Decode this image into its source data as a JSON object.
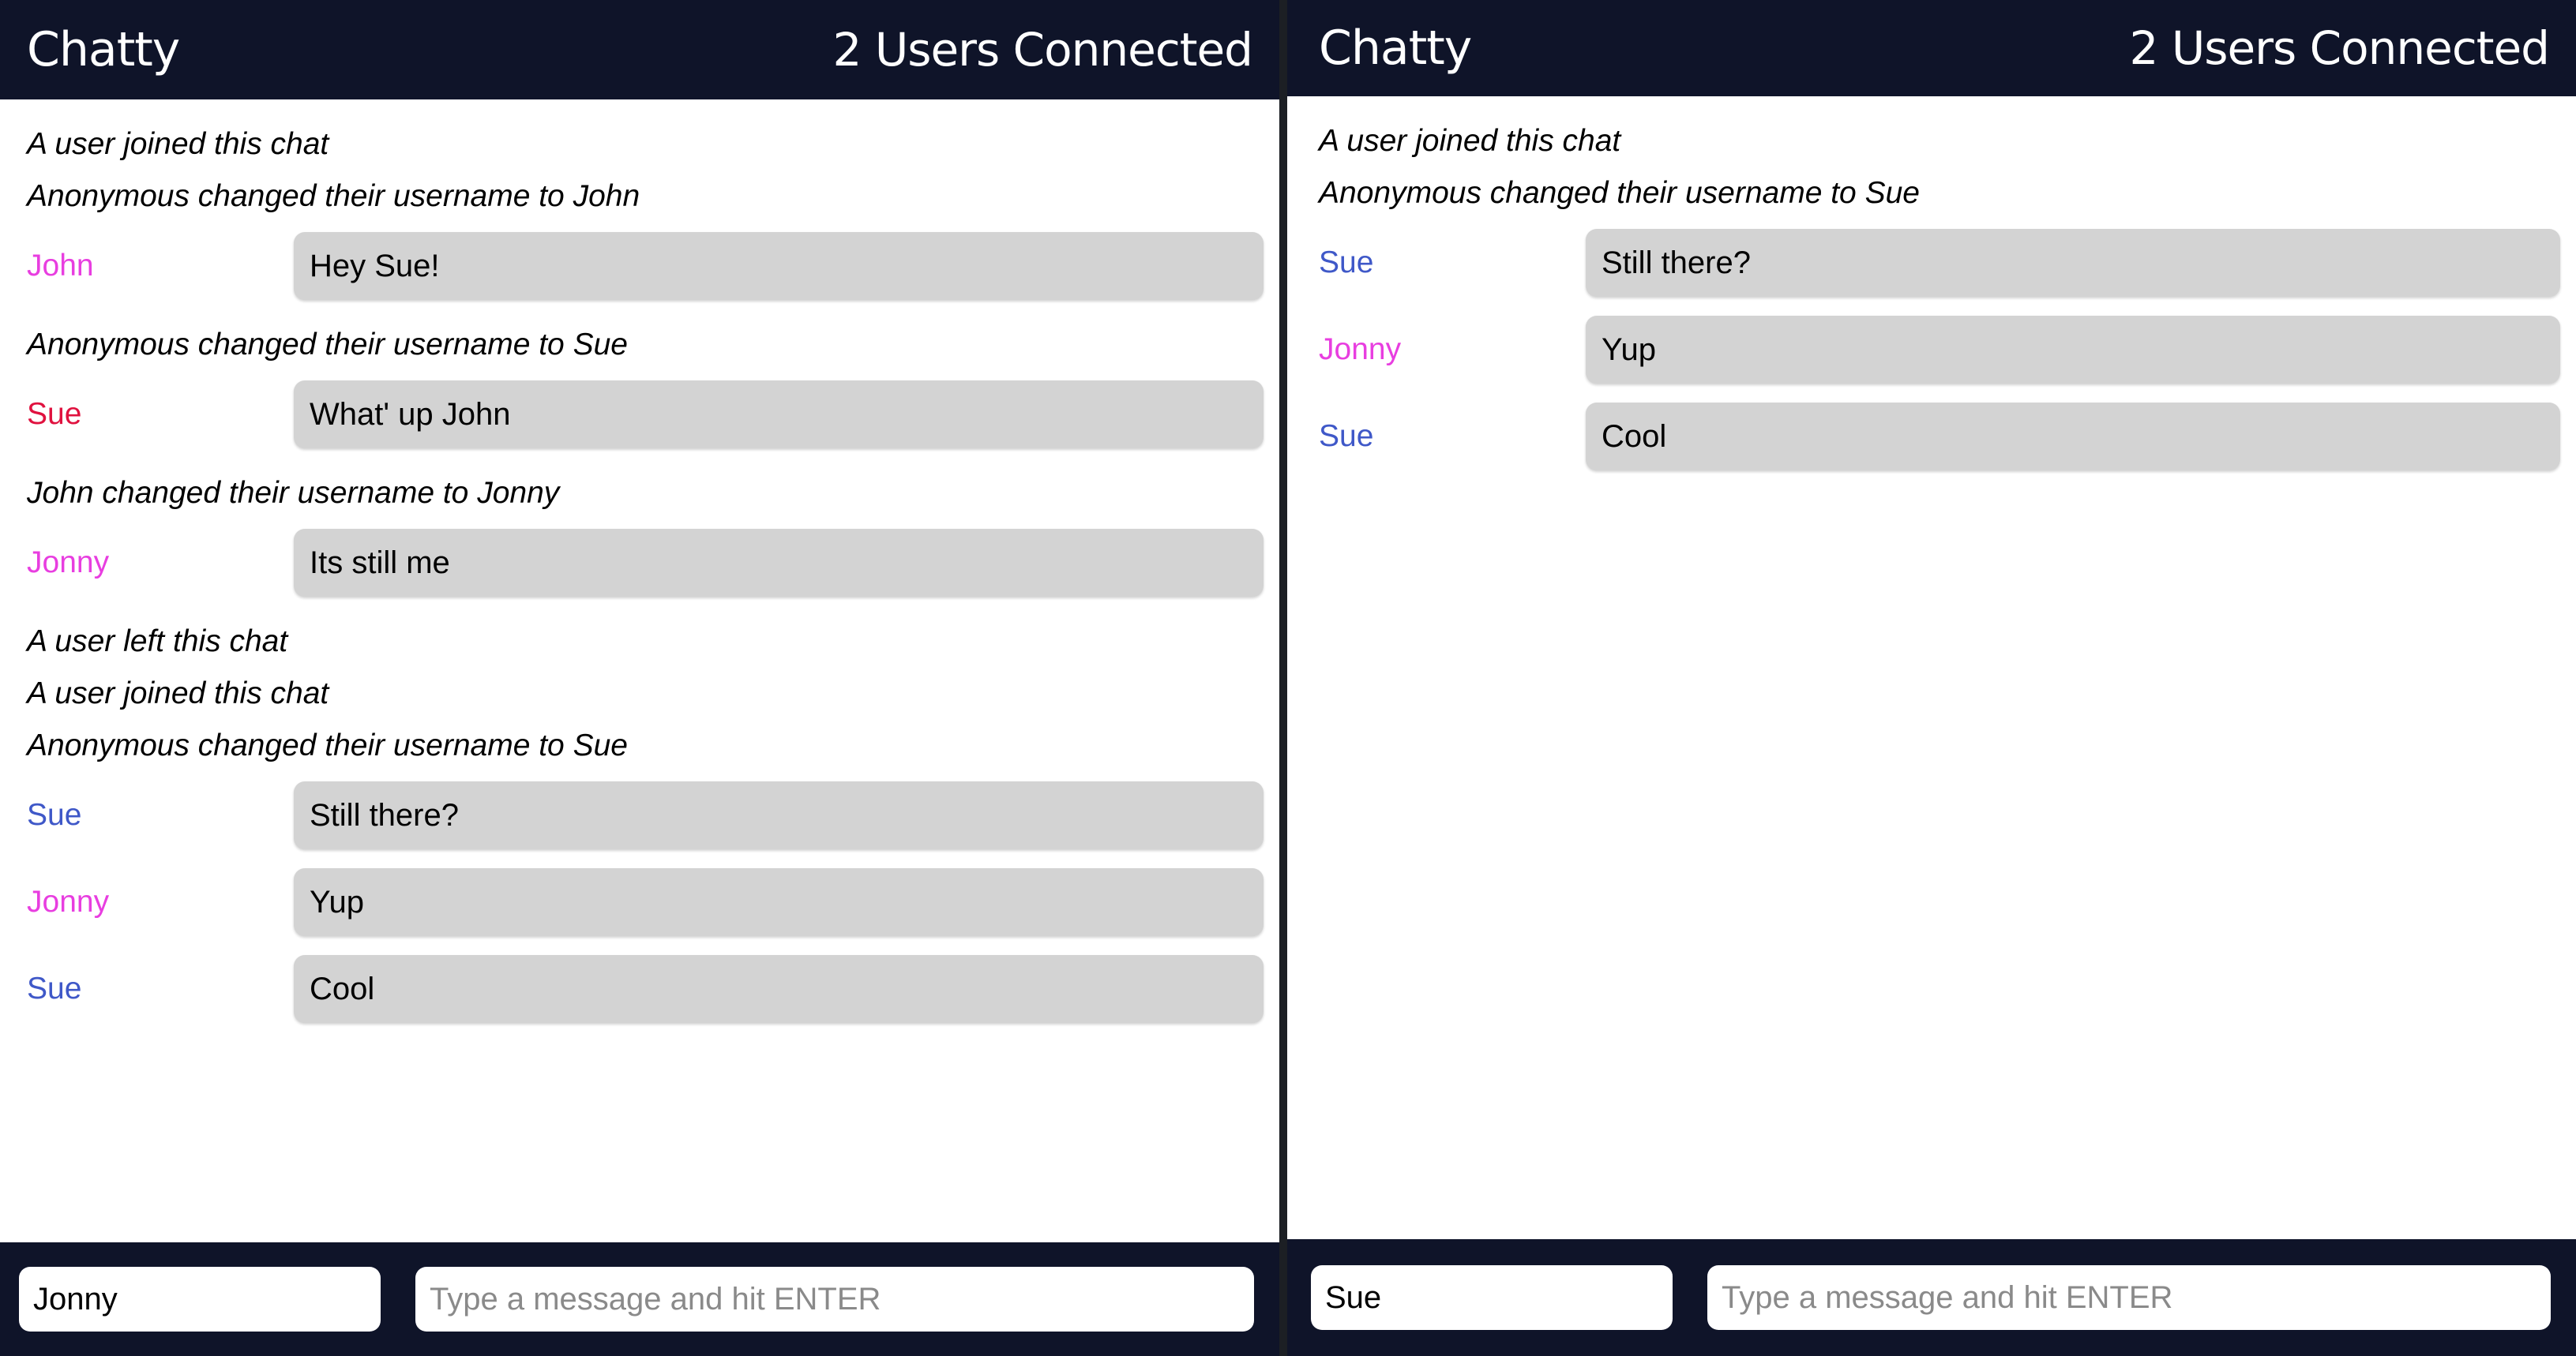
{
  "app": {
    "brand": "Chatty",
    "user_count_label": "2 Users Connected"
  },
  "colors": {
    "navbar": "#0f1429",
    "bubble": "#d3d3d3",
    "john_jonny": "#e83ee0",
    "sue_red": "#e0123f",
    "sue_blue": "#3f58c8"
  },
  "left": {
    "entries": [
      {
        "kind": "notification",
        "text": "A user joined this chat"
      },
      {
        "kind": "notification",
        "text": "Anonymous changed their username to John"
      },
      {
        "kind": "message",
        "user": "John",
        "color": "#e83ee0",
        "text": "Hey Sue!"
      },
      {
        "kind": "notification",
        "text": "Anonymous changed their username to Sue"
      },
      {
        "kind": "message",
        "user": "Sue",
        "color": "#e0123f",
        "text": "What' up John"
      },
      {
        "kind": "notification",
        "text": "John changed their username to Jonny"
      },
      {
        "kind": "message",
        "user": "Jonny",
        "color": "#e83ee0",
        "text": "Its still me"
      },
      {
        "kind": "notification",
        "text": "A user left this chat"
      },
      {
        "kind": "notification",
        "text": "A user joined this chat"
      },
      {
        "kind": "notification",
        "text": "Anonymous changed their username to Sue"
      },
      {
        "kind": "message",
        "user": "Sue",
        "color": "#3f58c8",
        "text": "Still there?"
      },
      {
        "kind": "message",
        "user": "Jonny",
        "color": "#e83ee0",
        "text": "Yup"
      },
      {
        "kind": "message",
        "user": "Sue",
        "color": "#3f58c8",
        "text": "Cool"
      }
    ],
    "footer": {
      "username_value": "Jonny",
      "message_placeholder": "Type a message and hit ENTER"
    }
  },
  "right": {
    "entries": [
      {
        "kind": "notification",
        "text": "A user joined this chat"
      },
      {
        "kind": "notification",
        "text": "Anonymous changed their username to Sue"
      },
      {
        "kind": "message",
        "user": "Sue",
        "color": "#3f58c8",
        "text": "Still there?"
      },
      {
        "kind": "message",
        "user": "Jonny",
        "color": "#e83ee0",
        "text": "Yup"
      },
      {
        "kind": "message",
        "user": "Sue",
        "color": "#3f58c8",
        "text": "Cool"
      }
    ],
    "footer": {
      "username_value": "Sue",
      "message_placeholder": "Type a message and hit ENTER"
    }
  }
}
